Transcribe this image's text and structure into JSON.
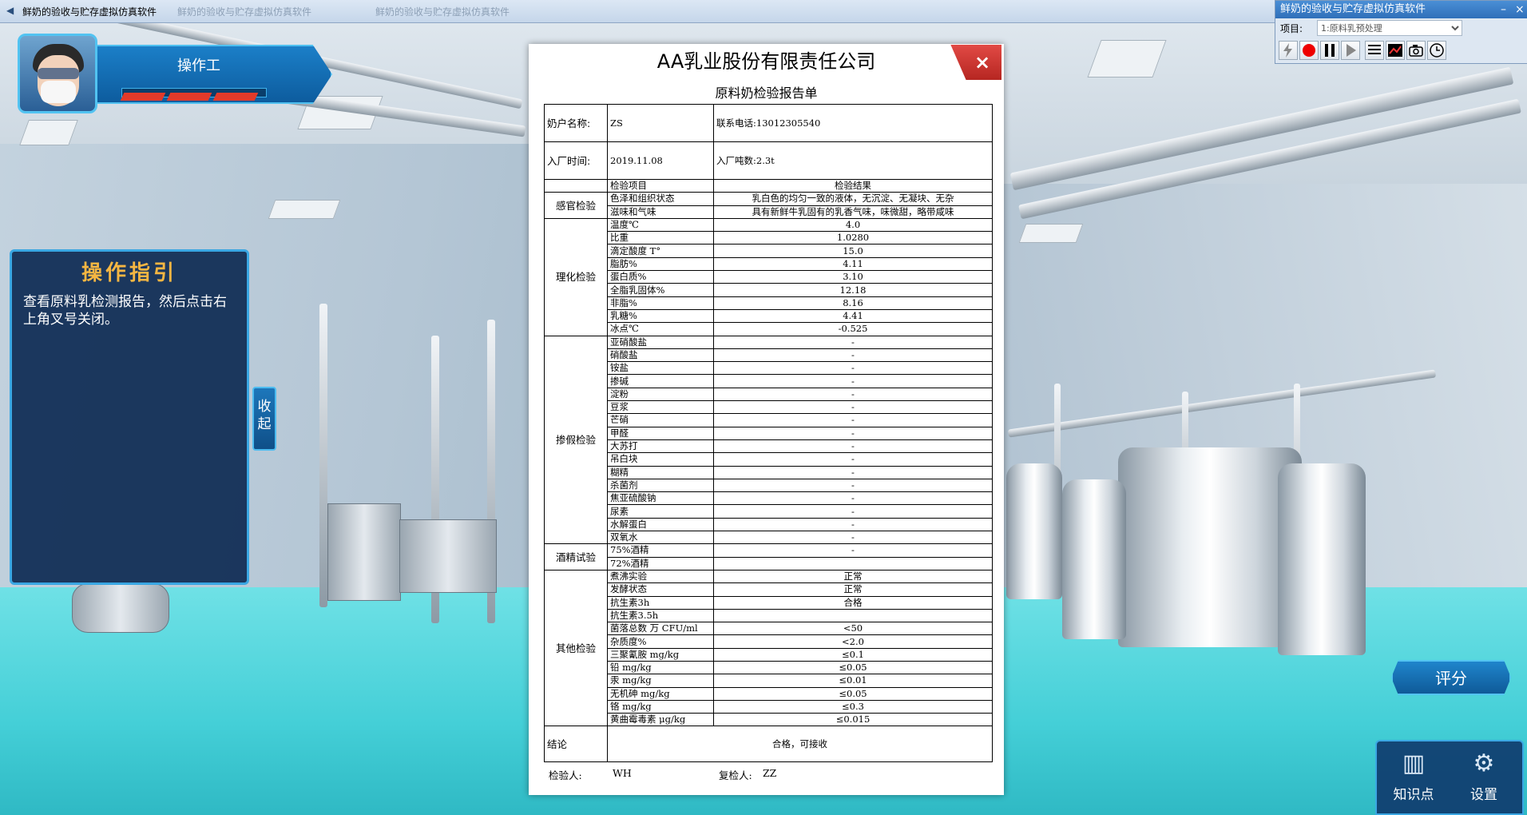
{
  "window": {
    "title": "鲜奶的验收与贮存虚拟仿真软件",
    "faded_tab": "鲜奶的验收与贮存虚拟仿真软件"
  },
  "control_panel": {
    "title": "鲜奶的验收与贮存虚拟仿真软件",
    "project_label": "项目:",
    "project_value": "1:原料乳预处理",
    "minimize": "–",
    "close": "×"
  },
  "operator": {
    "role": "操作工"
  },
  "guide": {
    "title": "操作指引",
    "text": "查看原料乳检测报告，然后点击右上角叉号关闭。",
    "collapse": "收起"
  },
  "report": {
    "company": "AA乳业股份有限责任公司",
    "subtitle": "原料奶检验报告单",
    "close": "×",
    "info": {
      "owner_label": "奶户名称:",
      "owner_value": "ZS",
      "phone_label": "联系电话:",
      "phone_value": "13012305540",
      "time_label": "入厂时间:",
      "time_value": "2019.11.08",
      "tons_label": "入厂吨数:",
      "tons_value": "2.3t"
    },
    "header": {
      "item": "检验项目",
      "result": "检验结果"
    },
    "groups": [
      {
        "category": "感官检验",
        "rows": [
          {
            "item": "色泽和组织状态",
            "result": "乳白色的均匀一致的液体，无沉淀、无凝块、无杂"
          },
          {
            "item": "滋味和气味",
            "result": "具有新鲜牛乳固有的乳香气味，味微甜，略带咸味"
          }
        ]
      },
      {
        "category": "理化检验",
        "rows": [
          {
            "item": "温度℃",
            "result": "4.0"
          },
          {
            "item": "比重",
            "result": "1.0280"
          },
          {
            "item": "滴定酸度 T°",
            "result": "15.0"
          },
          {
            "item": "脂肪%",
            "result": "4.11"
          },
          {
            "item": "蛋白质%",
            "result": "3.10"
          },
          {
            "item": "全脂乳固体%",
            "result": "12.18"
          },
          {
            "item": "非脂%",
            "result": "8.16"
          },
          {
            "item": "乳糖%",
            "result": "4.41"
          },
          {
            "item": "冰点℃",
            "result": "-0.525"
          }
        ]
      },
      {
        "category": "掺假检验",
        "rows": [
          {
            "item": "亚硝酸盐",
            "result": "-"
          },
          {
            "item": "硝酸盐",
            "result": "-"
          },
          {
            "item": "铵盐",
            "result": "-"
          },
          {
            "item": "掺碱",
            "result": "-"
          },
          {
            "item": "淀粉",
            "result": "-"
          },
          {
            "item": "豆浆",
            "result": "-"
          },
          {
            "item": "芒硝",
            "result": "-"
          },
          {
            "item": "甲醛",
            "result": "-"
          },
          {
            "item": "大苏打",
            "result": "-"
          },
          {
            "item": "吊白块",
            "result": "-"
          },
          {
            "item": "糊精",
            "result": "-"
          },
          {
            "item": "杀菌剂",
            "result": "-"
          },
          {
            "item": "焦亚硫酸钠",
            "result": "-"
          },
          {
            "item": "尿素",
            "result": "-"
          },
          {
            "item": "水解蛋白",
            "result": "-"
          },
          {
            "item": "双氧水",
            "result": "-"
          }
        ]
      },
      {
        "category": "酒精试验",
        "rows": [
          {
            "item": "75%酒精",
            "result": "-"
          },
          {
            "item": "72%酒精",
            "result": ""
          }
        ]
      },
      {
        "category": "其他检验",
        "rows": [
          {
            "item": "煮沸实验",
            "result": "正常"
          },
          {
            "item": "发酵状态",
            "result": "正常"
          },
          {
            "item": "抗生素3h",
            "result": "合格"
          },
          {
            "item": "抗生素3.5h",
            "result": ""
          },
          {
            "item": "菌落总数 万 CFU/ml",
            "result": "<50"
          },
          {
            "item": "杂质度%",
            "result": "<2.0"
          },
          {
            "item": "三聚氰胺 mg/kg",
            "result": "≤0.1"
          },
          {
            "item": "铅 mg/kg",
            "result": "≤0.05"
          },
          {
            "item": "汞 mg/kg",
            "result": "≤0.01"
          },
          {
            "item": "无机砷 mg/kg",
            "result": "≤0.05"
          },
          {
            "item": "铬 mg/kg",
            "result": "≤0.3"
          },
          {
            "item": "黄曲霉毒素 μg/kg",
            "result": "≤0.015"
          }
        ]
      }
    ],
    "conclusion_label": "结论",
    "conclusion_value": "合格，可接收",
    "inspector_label": "检验人:",
    "inspector_value": "WH",
    "reviewer_label": "复检人:",
    "reviewer_value": "ZZ"
  },
  "buttons": {
    "score": "评分",
    "knowledge": "知识点",
    "settings": "设置"
  },
  "colors": {
    "accent": "#1f85cc",
    "guide_title": "#f5b642",
    "close_red": "#d23a35",
    "floor": "#49c9d4"
  }
}
